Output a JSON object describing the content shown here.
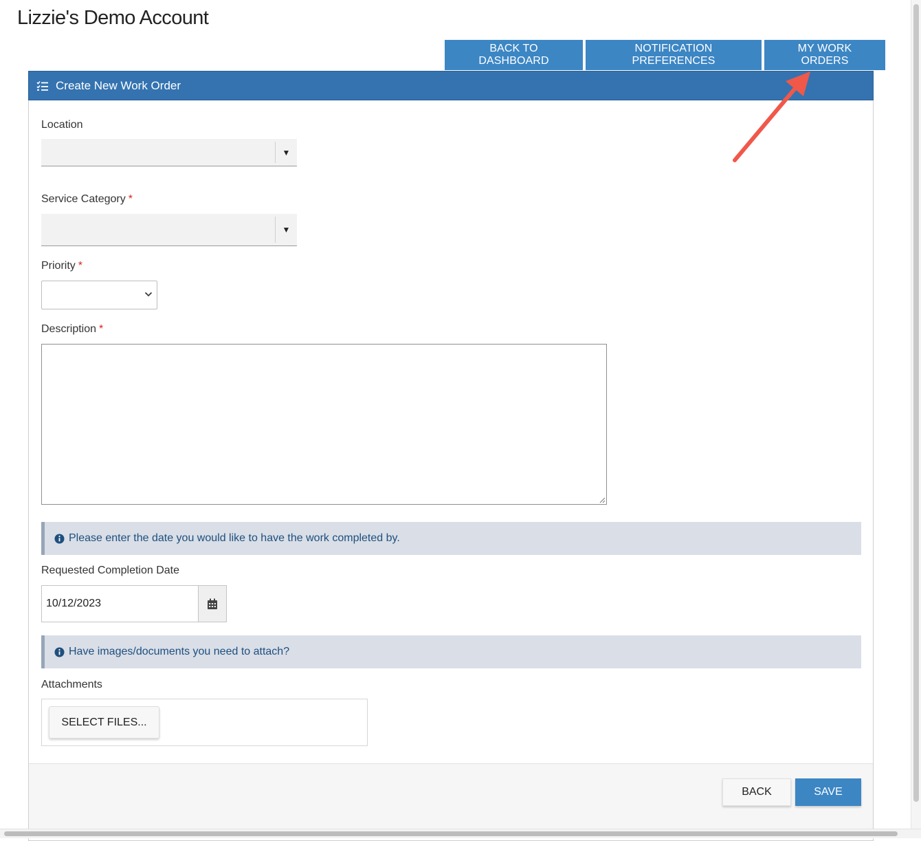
{
  "account": {
    "title": "Lizzie's Demo Account"
  },
  "top_nav": {
    "back_to_dashboard": "BACK TO DASHBOARD",
    "notification_preferences": "NOTIFICATION PREFERENCES",
    "my_work_orders": "MY WORK ORDERS"
  },
  "panel": {
    "title": "Create New Work Order",
    "icon": "checklist-icon"
  },
  "form": {
    "location": {
      "label": "Location",
      "value": ""
    },
    "service_category": {
      "label": "Service Category",
      "required_mark": "*",
      "value": ""
    },
    "priority": {
      "label": "Priority",
      "required_mark": "*",
      "value": ""
    },
    "description": {
      "label": "Description",
      "required_mark": "*",
      "value": ""
    },
    "date_info": "Please enter the date you would like to have the work completed by.",
    "requested_completion_date": {
      "label": "Requested Completion Date",
      "value": "10/12/2023"
    },
    "attach_info": "Have images/documents you need to attach?",
    "attachments": {
      "label": "Attachments",
      "select_files": "SELECT FILES..."
    }
  },
  "footer": {
    "back": "BACK",
    "save": "SAVE"
  },
  "colors": {
    "accent": "#3c86c4",
    "header": "#3473b0",
    "info_bg": "#d9dee7",
    "info_text": "#1e4f7e",
    "required": "#d9251c",
    "annotation_arrow": "#f0584a"
  }
}
